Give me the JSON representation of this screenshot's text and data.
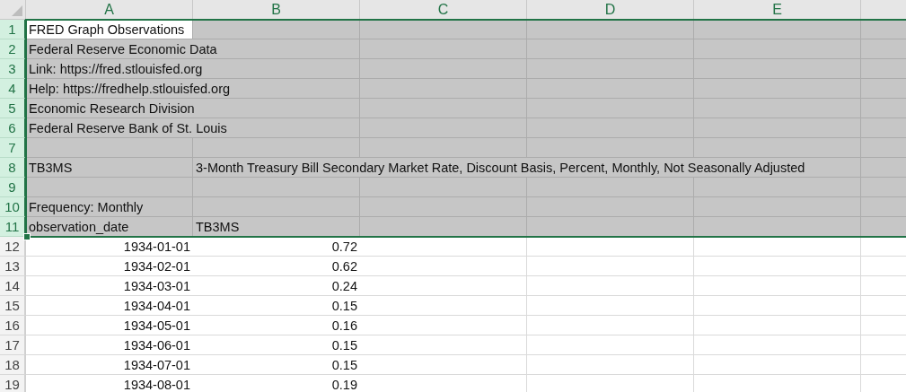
{
  "columns": [
    {
      "label": "A",
      "selected": true
    },
    {
      "label": "B",
      "selected": true
    },
    {
      "label": "C",
      "selected": true
    },
    {
      "label": "D",
      "selected": true
    },
    {
      "label": "E",
      "selected": true
    }
  ],
  "rows": [
    {
      "number": "1",
      "selected": true,
      "kind": "text",
      "cells": [
        "FRED Graph Observations"
      ]
    },
    {
      "number": "2",
      "selected": true,
      "kind": "text",
      "cells": [
        "Federal Reserve Economic Data"
      ]
    },
    {
      "number": "3",
      "selected": true,
      "kind": "text",
      "cells": [
        "Link: https://fred.stlouisfed.org"
      ]
    },
    {
      "number": "4",
      "selected": true,
      "kind": "text",
      "cells": [
        "Help: https://fredhelp.stlouisfed.org"
      ]
    },
    {
      "number": "5",
      "selected": true,
      "kind": "text",
      "cells": [
        "Economic Research Division"
      ]
    },
    {
      "number": "6",
      "selected": true,
      "kind": "text",
      "cells": [
        "Federal Reserve Bank of St. Louis"
      ]
    },
    {
      "number": "7",
      "selected": true,
      "kind": "text"
    },
    {
      "number": "8",
      "selected": true,
      "kind": "text",
      "cells": [
        "TB3MS",
        "3-Month Treasury Bill Secondary Market Rate, Discount Basis, Percent, Monthly, Not Seasonally Adjusted"
      ]
    },
    {
      "number": "9",
      "selected": true,
      "kind": "text"
    },
    {
      "number": "10",
      "selected": true,
      "kind": "text",
      "cells": [
        "Frequency: Monthly"
      ]
    },
    {
      "number": "11",
      "selected": true,
      "kind": "text",
      "cells": [
        "observation_date",
        "TB3MS"
      ]
    },
    {
      "number": "12",
      "selected": false,
      "kind": "value",
      "cells": [
        "1934-01-01",
        "0.72"
      ]
    },
    {
      "number": "13",
      "selected": false,
      "kind": "value",
      "cells": [
        "1934-02-01",
        "0.62"
      ]
    },
    {
      "number": "14",
      "selected": false,
      "kind": "value",
      "cells": [
        "1934-03-01",
        "0.24"
      ]
    },
    {
      "number": "15",
      "selected": false,
      "kind": "value",
      "cells": [
        "1934-04-01",
        "0.15"
      ]
    },
    {
      "number": "16",
      "selected": false,
      "kind": "value",
      "cells": [
        "1934-05-01",
        "0.16"
      ]
    },
    {
      "number": "17",
      "selected": false,
      "kind": "value",
      "cells": [
        "1934-06-01",
        "0.15"
      ]
    },
    {
      "number": "18",
      "selected": false,
      "kind": "value",
      "cells": [
        "1934-07-01",
        "0.15"
      ]
    },
    {
      "number": "19",
      "selected": false,
      "kind": "value",
      "cells": [
        "1934-08-01",
        "0.19"
      ]
    }
  ]
}
